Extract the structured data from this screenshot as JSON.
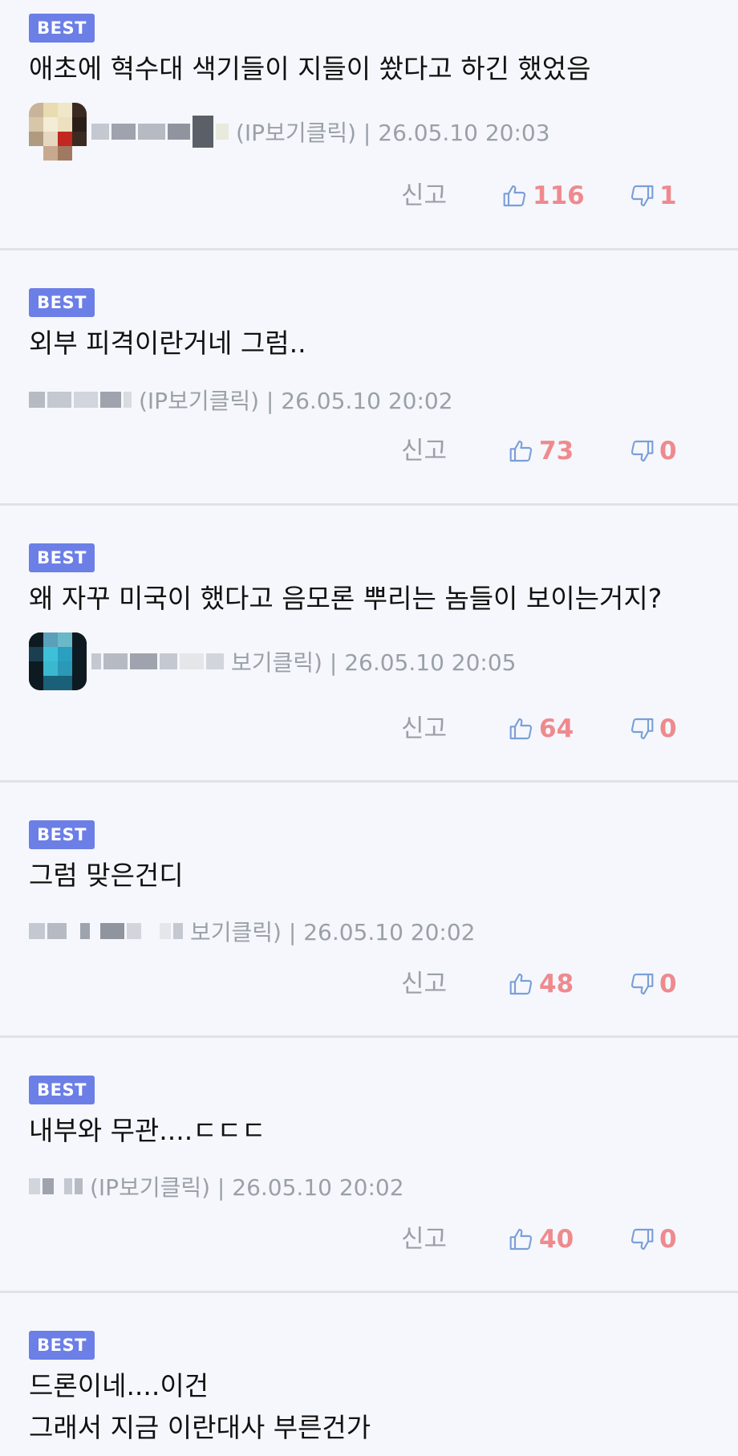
{
  "best_label": "BEST",
  "report_label": "신고",
  "comments": [
    {
      "text_lines": [
        "애초에 혁수대 색기들이 지들이 쐈다고 하긴 했었음"
      ],
      "meta": "(IP보기클릭) | 26.05.10 20:03",
      "likes": "116",
      "dislikes": "1"
    },
    {
      "text_lines": [
        "외부 피격이란거네 그럼.."
      ],
      "meta": "(IP보기클릭) | 26.05.10 20:02",
      "likes": "73",
      "dislikes": "0"
    },
    {
      "text_lines": [
        "왜 자꾸 미국이 했다고 음모론 뿌리는 놈들이 보이는거지?"
      ],
      "meta": "보기클릭) | 26.05.10 20:05",
      "likes": "64",
      "dislikes": "0"
    },
    {
      "text_lines": [
        "그럼  맞은건디"
      ],
      "meta": "보기클릭) | 26.05.10 20:02",
      "likes": "48",
      "dislikes": "0"
    },
    {
      "text_lines": [
        "내부와 무관....ㄷㄷㄷ"
      ],
      "meta": "(IP보기클릭) | 26.05.10 20:02",
      "likes": "40",
      "dislikes": "0"
    },
    {
      "text_lines": [
        "드론이네....이건",
        "그래서 지금 이란대사 부른건가"
      ]
    }
  ],
  "colors": {
    "badge": "#6c7fe6",
    "count": "#ee8a8e",
    "thumb_icon": "#7a9fd8",
    "muted": "#9aa0a8"
  },
  "icons": {
    "like": "thumbs-up-icon",
    "dislike": "thumbs-down-icon"
  }
}
